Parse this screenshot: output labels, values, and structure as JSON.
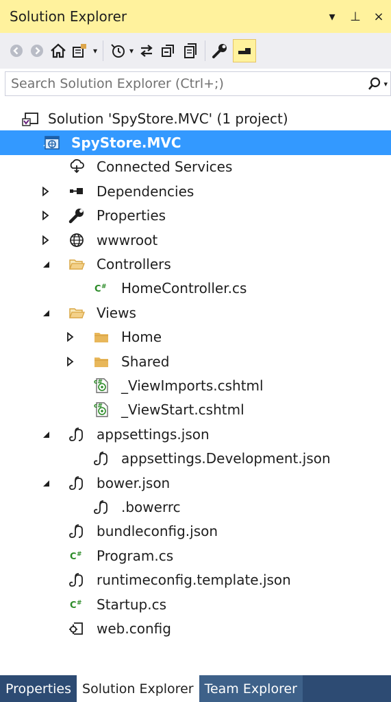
{
  "window": {
    "title": "Solution Explorer",
    "controls": [
      "▾",
      "⊥",
      "×"
    ]
  },
  "toolbar": {
    "icons": [
      "back-icon",
      "forward-icon",
      "home-icon",
      "switch-views-icon",
      "pending-changes-icon",
      "sync-icon",
      "collapse-all-icon",
      "show-all-files-icon",
      "properties-wrench-icon",
      "preview-selected-icon"
    ]
  },
  "search": {
    "placeholder": "Search Solution Explorer (Ctrl+;)",
    "value": ""
  },
  "tree": [
    {
      "label": "Solution 'SpyStore.MVC' (1 project)",
      "icon": "solution-icon",
      "level": 0,
      "expander": "none"
    },
    {
      "label": "SpyStore.MVC",
      "icon": "web-project-icon",
      "level": 1,
      "expander": "expanded",
      "selected": true
    },
    {
      "label": "Connected Services",
      "icon": "connected-services-icon",
      "level": 2,
      "expander": "none"
    },
    {
      "label": "Dependencies",
      "icon": "dependencies-icon",
      "level": 2,
      "expander": "collapsed"
    },
    {
      "label": "Properties",
      "icon": "wrench-icon",
      "level": 2,
      "expander": "collapsed"
    },
    {
      "label": "wwwroot",
      "icon": "globe-icon",
      "level": 2,
      "expander": "collapsed"
    },
    {
      "label": "Controllers",
      "icon": "folder-open-icon",
      "level": 2,
      "expander": "expanded"
    },
    {
      "label": "HomeController.cs",
      "icon": "csharp-file-icon",
      "level": 3,
      "expander": "none"
    },
    {
      "label": "Views",
      "icon": "folder-open-icon",
      "level": 2,
      "expander": "expanded"
    },
    {
      "label": "Home",
      "icon": "folder-icon",
      "level": 3,
      "expander": "collapsed"
    },
    {
      "label": "Shared",
      "icon": "folder-icon",
      "level": 3,
      "expander": "collapsed"
    },
    {
      "label": "_ViewImports.cshtml",
      "icon": "razor-file-icon",
      "level": 3,
      "expander": "none"
    },
    {
      "label": "_ViewStart.cshtml",
      "icon": "razor-file-icon",
      "level": 3,
      "expander": "none"
    },
    {
      "label": "appsettings.json",
      "icon": "json-file-icon",
      "level": 2,
      "expander": "expanded"
    },
    {
      "label": "appsettings.Development.json",
      "icon": "json-file-icon",
      "level": 3,
      "expander": "none"
    },
    {
      "label": "bower.json",
      "icon": "json-file-icon",
      "level": 2,
      "expander": "expanded"
    },
    {
      "label": ".bowerrc",
      "icon": "json-file-icon",
      "level": 3,
      "expander": "none"
    },
    {
      "label": "bundleconfig.json",
      "icon": "json-file-icon",
      "level": 2,
      "expander": "none"
    },
    {
      "label": "Program.cs",
      "icon": "csharp-file-icon",
      "level": 2,
      "expander": "none"
    },
    {
      "label": "runtimeconfig.template.json",
      "icon": "json-file-icon",
      "level": 2,
      "expander": "none"
    },
    {
      "label": "Startup.cs",
      "icon": "csharp-file-icon",
      "level": 2,
      "expander": "none"
    },
    {
      "label": "web.config",
      "icon": "config-file-icon",
      "level": 2,
      "expander": "none"
    }
  ],
  "bottom_tabs": [
    {
      "label": "Properties",
      "active": false
    },
    {
      "label": "Solution Explorer",
      "active": true
    },
    {
      "label": "Team Explorer",
      "active": false
    }
  ],
  "colors": {
    "title_bar": "#fff29d",
    "selection": "#3399ff",
    "tab_strip": "#2d4b73"
  }
}
